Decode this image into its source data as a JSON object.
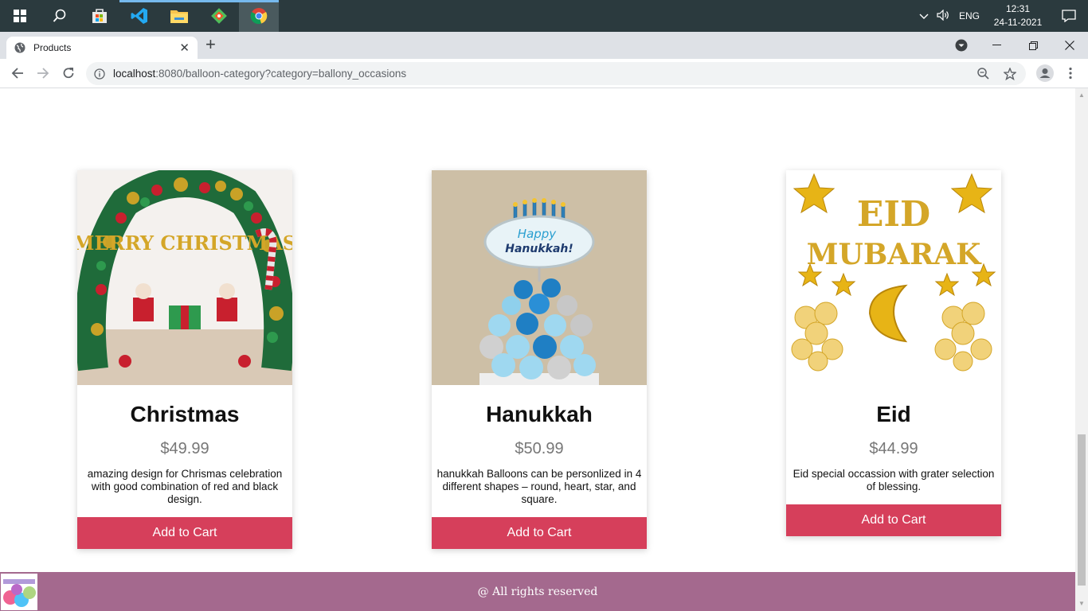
{
  "taskbar": {
    "apps": [
      "windows-start",
      "search",
      "store",
      "vscode",
      "file-explorer",
      "git",
      "chrome"
    ],
    "language": "ENG",
    "time": "12:31",
    "date": "24-11-2021"
  },
  "browser": {
    "tab_title": "Products",
    "url_host": "localhost",
    "url_rest": ":8080/balloon-category?category=ballony_occasions"
  },
  "products": [
    {
      "name": "Christmas",
      "price": "$49.99",
      "description": "amazing design for Chrismas celebration with good combination of red and black design.",
      "button": "Add to Cart"
    },
    {
      "name": "Hanukkah",
      "price": "$50.99",
      "description": "hanukkah Balloons can be personlized in 4 different shapes – round, heart, star, and square.",
      "button": "Add to Cart"
    },
    {
      "name": "Eid",
      "price": "$44.99",
      "description": "Eid special occassion with grater selection of blessing.",
      "button": "Add to Cart"
    }
  ],
  "images": {
    "christmas_text": "MERRY CHRISTMAS",
    "hanukkah_text_1": "Happy",
    "hanukkah_text_2": "Hanukkah!",
    "eid_text_1": "EID",
    "eid_text_2": "MUBARAK"
  },
  "footer": {
    "text": "@ All rights reserved"
  },
  "colors": {
    "button": "#d63f5b",
    "footer": "#a4698e",
    "taskbar": "#2b3a3e"
  }
}
